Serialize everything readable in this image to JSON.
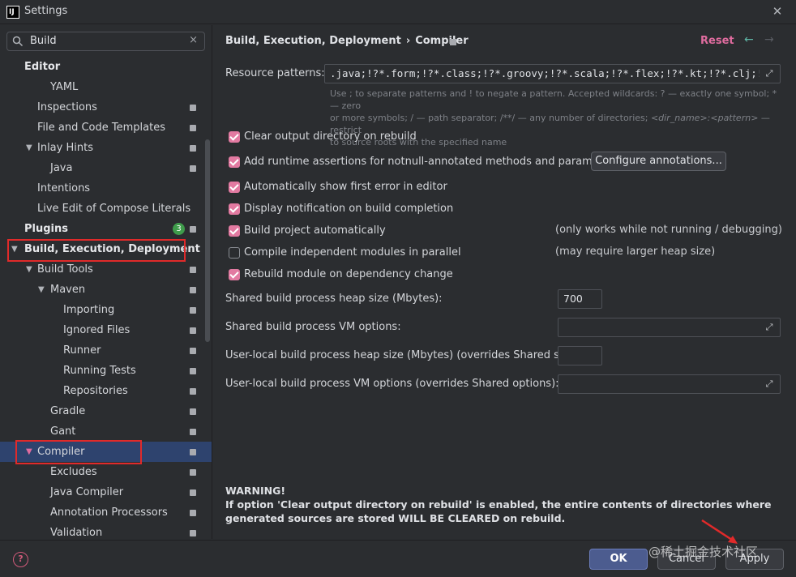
{
  "window": {
    "title": "Settings",
    "close_glyph": "✕"
  },
  "sidebar": {
    "search_value": "Build",
    "search_clear": "×",
    "plugins_badge": "3",
    "items": [
      {
        "label": "Editor"
      },
      {
        "label": "YAML"
      },
      {
        "label": "Inspections"
      },
      {
        "label": "File and Code Templates"
      },
      {
        "label": "Inlay Hints"
      },
      {
        "label": "Java"
      },
      {
        "label": "Intentions"
      },
      {
        "label": "Live Edit of Compose Literals"
      },
      {
        "label": "Plugins"
      },
      {
        "label": "Build, Execution, Deployment"
      },
      {
        "label": "Build Tools"
      },
      {
        "label": "Maven"
      },
      {
        "label": "Importing"
      },
      {
        "label": "Ignored Files"
      },
      {
        "label": "Runner"
      },
      {
        "label": "Running Tests"
      },
      {
        "label": "Repositories"
      },
      {
        "label": "Gradle"
      },
      {
        "label": "Gant"
      },
      {
        "label": "Compiler"
      },
      {
        "label": "Excludes"
      },
      {
        "label": "Java Compiler"
      },
      {
        "label": "Annotation Processors"
      },
      {
        "label": "Validation"
      }
    ]
  },
  "main": {
    "breadcrumb": {
      "parent": "Build, Execution, Deployment",
      "separator": "›",
      "current": "Compiler"
    },
    "reset_label": "Reset",
    "nav_back": "←",
    "nav_forward": "→",
    "resource_patterns": {
      "label": "Resource patterns:",
      "value": ".java;!?*.form;!?*.class;!?*.groovy;!?*.scala;!?*.flex;!?*.kt;!?*.clj;!?*.aj",
      "hint_1": "Use ; to separate patterns and ! to negate a pattern. Accepted wildcards: ? — exactly one symbol; * — zero",
      "hint_2": "or more symbols; / — path separator; /**/ — any number of directories; ",
      "hint_dir": "<dir_name>:<pattern>",
      "hint_3": " — restrict",
      "hint_4": "to source roots with the specified name"
    },
    "options": [
      {
        "label": "Clear output directory on rebuild",
        "checked": true
      },
      {
        "label": "Add runtime assertions for notnull-annotated methods and parameters",
        "checked": true
      },
      {
        "label": "Automatically show first error in editor",
        "checked": true
      },
      {
        "label": "Display notification on build completion",
        "checked": true
      },
      {
        "label": "Build project automatically",
        "checked": true
      },
      {
        "label": "Compile independent modules in parallel",
        "checked": false
      },
      {
        "label": "Rebuild module on dependency change",
        "checked": true
      }
    ],
    "configure_annotations_label": "Configure annotations...",
    "note_build_auto": "(only works while not running / debugging)",
    "note_parallel": "(may require larger heap size)",
    "heap_size": {
      "label": "Shared build process heap size (Mbytes):",
      "value": "700"
    },
    "vm_options": {
      "label": "Shared build process VM options:",
      "value": ""
    },
    "user_heap": {
      "label": "User-local build process heap size (Mbytes) (overrides Shared size):",
      "value": ""
    },
    "user_vm": {
      "label": "User-local build process VM options (overrides Shared options):",
      "value": ""
    },
    "warning_title": "WARNING!",
    "warning_text": "If option 'Clear output directory on rebuild' is enabled, the entire contents of directories where generated sources are stored WILL BE CLEARED on rebuild."
  },
  "footer": {
    "help_glyph": "?",
    "ok_label": "OK",
    "cancel_label": "Cancel",
    "apply_label": "Apply",
    "watermark": "@稀土掘金技术社区"
  },
  "colors": {
    "accent_checkbox": "#e27aa1",
    "highlight_box": "#e02a2a",
    "selection": "#2e436e"
  }
}
